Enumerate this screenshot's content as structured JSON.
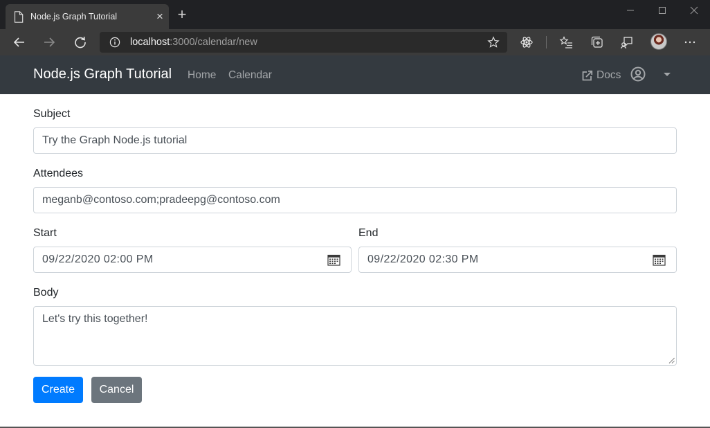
{
  "browser": {
    "tab_title": "Node.js Graph Tutorial",
    "new_tab_symbol": "+",
    "close_symbol": "×",
    "url_host": "localhost",
    "url_path": ":3000/calendar/new"
  },
  "navbar": {
    "brand": "Node.js Graph Tutorial",
    "links": [
      "Home",
      "Calendar"
    ],
    "docs": "Docs"
  },
  "form": {
    "subject_label": "Subject",
    "subject_value": "Try the Graph Node.js tutorial",
    "attendees_label": "Attendees",
    "attendees_value": "meganb@contoso.com;pradeepg@contoso.com",
    "start_label": "Start",
    "start_value": "09/22/2020 02:00  PM",
    "end_label": "End",
    "end_value": "09/22/2020 02:30  PM",
    "body_label": "Body",
    "body_value": "Let's try this together!",
    "create_label": "Create",
    "cancel_label": "Cancel"
  },
  "colors": {
    "navbar_bg": "#343a40",
    "primary": "#007bff",
    "secondary": "#6c757d"
  }
}
